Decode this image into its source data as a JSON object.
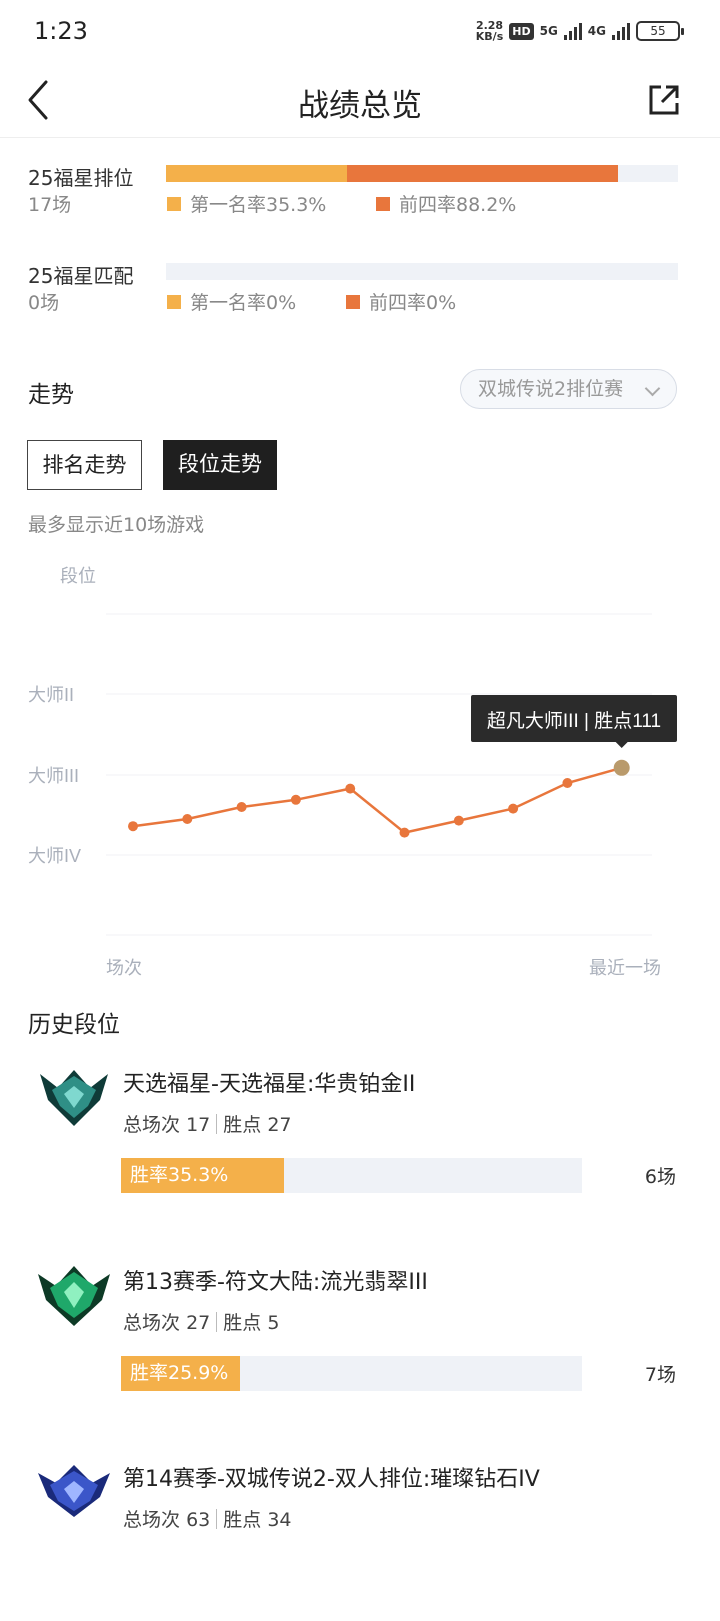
{
  "status": {
    "time": "1:23",
    "net_speed_value": "2.28",
    "net_speed_unit": "KB/s",
    "hd": "HD",
    "sig1": "5G",
    "sig2": "4G",
    "battery": "55"
  },
  "header": {
    "title": "战绩总览"
  },
  "stats": [
    {
      "name": "25福星排位",
      "count": "17场",
      "first_label": "第一名率35.3%",
      "top4_label": "前四率88.2%",
      "first_rate": 0.353,
      "top4_rate": 0.882
    },
    {
      "name": "25福星匹配",
      "count": "0场",
      "first_label": "第一名率0%",
      "top4_label": "前四率0%",
      "first_rate": 0,
      "top4_rate": 0
    }
  ],
  "trend": {
    "title": "走势",
    "season_select": "双城传说2排位赛",
    "tabs": [
      "排名走势",
      "段位走势"
    ],
    "active_tab": 1,
    "hint": "最多显示近10场游戏"
  },
  "chart_data": {
    "type": "line",
    "ylabel": "段位",
    "xlabel_left": "场次",
    "xlabel_right": "最近一场",
    "y_tick_labels": [
      "大师II",
      "大师III",
      "大师IV"
    ],
    "tooltip": "超凡大师III | 胜点111",
    "series": [
      {
        "values": [
          0.36,
          0.45,
          0.6,
          0.69,
          0.83,
          0.28,
          0.43,
          0.58,
          0.9,
          1.09
        ]
      }
    ],
    "colors": {
      "line": "#e8763c",
      "highlight": "#b99a6b",
      "tooltip_bg": "#2b2b2b"
    }
  },
  "history": {
    "title": "历史段位",
    "items": [
      {
        "title": "天选福星-天选福星:华贵铂金II",
        "games_label": "总场次",
        "games": "17",
        "points_label": "胜点",
        "points": "27",
        "win_label": "胜率35.3%",
        "win_rate": 0.353,
        "count": "6场",
        "emblem": "platinum-emblem-icon",
        "color": "#2f8f86"
      },
      {
        "title": "第13赛季-符文大陆:流光翡翠III",
        "games_label": "总场次",
        "games": "27",
        "points_label": "胜点",
        "points": "5",
        "win_label": "胜率25.9%",
        "win_rate": 0.259,
        "count": "7场",
        "emblem": "emerald-emblem-icon",
        "color": "#1fa86a"
      },
      {
        "title": "第14赛季-双城传说2-双人排位:璀璨钻石IV",
        "games_label": "总场次",
        "games": "63",
        "points_label": "胜点",
        "points": "34",
        "emblem": "diamond-emblem-icon",
        "color": "#3b56c9"
      }
    ]
  }
}
